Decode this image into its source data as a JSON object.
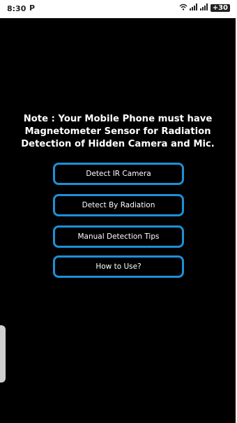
{
  "status_bar": {
    "time": "8:30",
    "app_badge": "P",
    "battery": "+30"
  },
  "icons": {
    "wifi": "wifi-icon",
    "signal_1": "signal-icon",
    "signal_2": "signal-icon",
    "battery": "battery-icon"
  },
  "main": {
    "note": "Note : Your Mobile Phone must have Magnetometer Sensor for Radiation Detection of Hidden Camera and Mic.",
    "buttons": [
      {
        "label": "Detect IR Camera"
      },
      {
        "label": "Detect By Radiation"
      },
      {
        "label": "Manual Detection Tips"
      },
      {
        "label": "How to Use?"
      }
    ]
  },
  "colors": {
    "background": "#000000",
    "button_border": "#1f8fd6",
    "text": "#ffffff"
  }
}
